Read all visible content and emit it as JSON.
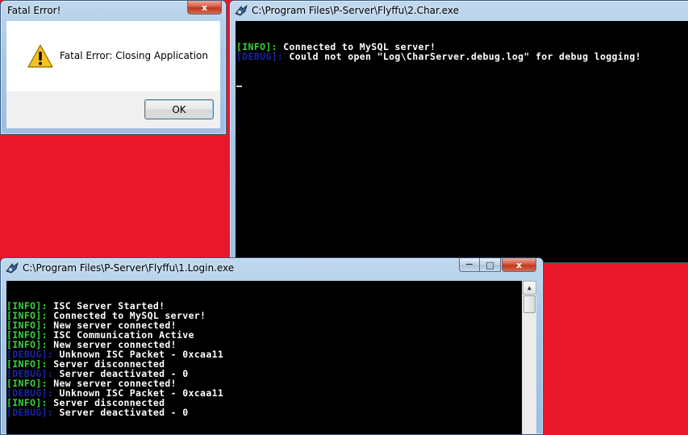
{
  "desktop": {
    "background_color": "#e8182a"
  },
  "dialog": {
    "title": "Fatal Error!",
    "message": "Fatal Error: Closing Application",
    "ok_label": "OK",
    "close_glyph": "x",
    "icon": "warning-icon"
  },
  "char_window": {
    "title": "C:\\Program Files\\P-Server\\Flyffu\\2.Char.exe",
    "lines": [
      {
        "tag": "[INFO]:",
        "type": "info",
        "text": " Connected to MySQL server!"
      },
      {
        "tag": "[DEBUG]:",
        "type": "debug",
        "text": " Could not open \"Log\\CharServer.debug.log\" for debug logging!"
      }
    ]
  },
  "login_window": {
    "title": "C:\\Program Files\\P-Server\\Flyffu\\1.Login.exe",
    "minimize_glyph": "—",
    "maximize_glyph": "□",
    "close_glyph": "x",
    "scroll_up_glyph": "▲",
    "lines": [
      {
        "tag": "[INFO]:",
        "type": "info",
        "text": " ISC Server Started!"
      },
      {
        "tag": "[INFO]:",
        "type": "info",
        "text": " Connected to MySQL server!"
      },
      {
        "tag": "[INFO]:",
        "type": "info",
        "text": " New server connected!"
      },
      {
        "tag": "[INFO]:",
        "type": "info",
        "text": " ISC Communication Active"
      },
      {
        "tag": "[INFO]:",
        "type": "info",
        "text": " New server connected!"
      },
      {
        "tag": "[DEBUG]:",
        "type": "debug",
        "text": " Unknown ISC Packet - 0xcaa11"
      },
      {
        "tag": "[INFO]:",
        "type": "info",
        "text": " Server disconnected"
      },
      {
        "tag": "[DEBUG]:",
        "type": "debug",
        "text": " Server deactivated - 0"
      },
      {
        "tag": "[INFO]:",
        "type": "info",
        "text": " New server connected!"
      },
      {
        "tag": "[DEBUG]:",
        "type": "debug",
        "text": " Unknown ISC Packet - 0xcaa11"
      },
      {
        "tag": "[INFO]:",
        "type": "info",
        "text": " Server disconnected"
      },
      {
        "tag": "[DEBUG]:",
        "type": "debug",
        "text": " Server deactivated - 0"
      }
    ]
  },
  "colors": {
    "info_tag": "#39d33c",
    "debug_tag": "#1726a8",
    "console_text": "#ffffff",
    "console_bg": "#000000"
  }
}
